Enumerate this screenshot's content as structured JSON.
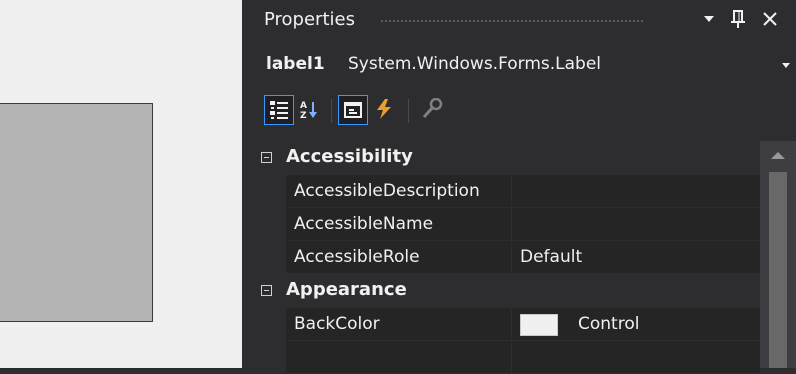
{
  "window": {
    "title": "Properties",
    "dropdown_icon": "▼",
    "pin_icon": "pin-icon",
    "close_icon": "close-icon"
  },
  "object_selector": {
    "name": "label1",
    "type": "System.Windows.Forms.Label"
  },
  "toolbar": [
    {
      "name": "categorized-icon",
      "active": true
    },
    {
      "name": "alphabetical-icon",
      "active": false
    },
    {
      "name": "properties-icon",
      "active": true
    },
    {
      "name": "events-icon",
      "active": false
    },
    {
      "name": "property-pages-icon",
      "active": false
    }
  ],
  "categories": [
    {
      "label": "Accessibility",
      "properties": [
        {
          "name": "AccessibleDescription",
          "value": ""
        },
        {
          "name": "AccessibleName",
          "value": ""
        },
        {
          "name": "AccessibleRole",
          "value": "Default"
        }
      ]
    },
    {
      "label": "Appearance",
      "properties": [
        {
          "name": "BackColor",
          "value": "Control",
          "swatch": "#f0f0f0"
        }
      ]
    }
  ],
  "colors": {
    "accent": "#3399ff",
    "panel_bg": "#2d2d30",
    "row_bg": "#252526",
    "designer_bg": "#f0f0f0",
    "control_bg": "#b4b4b4"
  }
}
